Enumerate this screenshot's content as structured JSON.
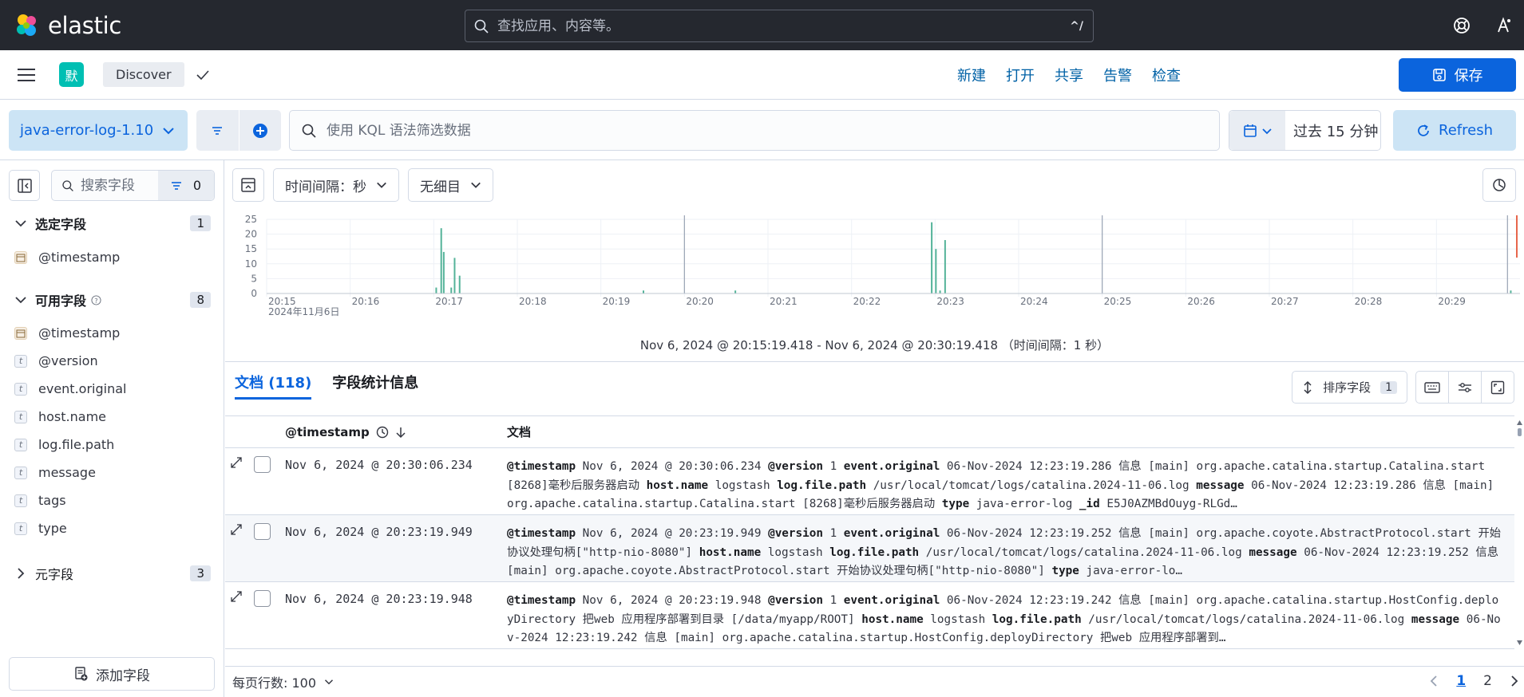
{
  "app": {
    "name": "elastic"
  },
  "global_search": {
    "placeholder": "查找应用、内容等。",
    "shortcut": "^/"
  },
  "header": {
    "space_initial": "默",
    "breadcrumb": "Discover",
    "links": [
      "新建",
      "打开",
      "共享",
      "告警",
      "检查"
    ],
    "save_label": "保存"
  },
  "querybar": {
    "dataview": "java-error-log-1.10",
    "kql_placeholder": "使用 KQL 语法筛选数据",
    "time_range": "过去 15 分钟",
    "refresh_label": "Refresh"
  },
  "sidebar": {
    "search_placeholder": "搜索字段",
    "filter_count": "0",
    "selected": {
      "label": "选定字段",
      "count": "1",
      "fields": [
        {
          "name": "@timestamp",
          "type": "date"
        }
      ]
    },
    "available": {
      "label": "可用字段",
      "count": "8",
      "fields": [
        {
          "name": "@timestamp",
          "type": "date"
        },
        {
          "name": "@version",
          "type": "t"
        },
        {
          "name": "event.original",
          "type": "t"
        },
        {
          "name": "host.name",
          "type": "t"
        },
        {
          "name": "log.file.path",
          "type": "t"
        },
        {
          "name": "message",
          "type": "t"
        },
        {
          "name": "tags",
          "type": "t"
        },
        {
          "name": "type",
          "type": "t"
        }
      ]
    },
    "meta": {
      "label": "元字段",
      "count": "3"
    },
    "add_field_label": "添加字段"
  },
  "chart_toolbar": {
    "interval": "时间间隔：秒",
    "breakdown": "无细目"
  },
  "chart_data": {
    "type": "bar",
    "y_ticks": [
      0,
      5,
      10,
      15,
      20,
      25
    ],
    "ylim": [
      0,
      25
    ],
    "x_tick_labels": [
      "20:15",
      "20:16",
      "20:17",
      "20:18",
      "20:19",
      "20:20",
      "20:21",
      "20:22",
      "20:23",
      "20:24",
      "20:25",
      "20:26",
      "20:27",
      "20:28",
      "20:29"
    ],
    "x_date_label": "2024年11月6日",
    "xlim_minutes": [
      0,
      15
    ],
    "points": [
      {
        "minute": 2.02,
        "count": 2
      },
      {
        "minute": 2.08,
        "count": 22
      },
      {
        "minute": 2.11,
        "count": 14
      },
      {
        "minute": 2.2,
        "count": 2
      },
      {
        "minute": 2.24,
        "count": 12
      },
      {
        "minute": 2.3,
        "count": 6
      },
      {
        "minute": 4.5,
        "count": 1
      },
      {
        "minute": 5.6,
        "count": 1
      },
      {
        "minute": 7.95,
        "count": 24
      },
      {
        "minute": 8.0,
        "count": 15
      },
      {
        "minute": 8.05,
        "count": 1
      },
      {
        "minute": 8.11,
        "count": 18
      },
      {
        "minute": 14.88,
        "count": 1
      }
    ],
    "color": "#54b399",
    "caption": "Nov 6, 2024 @ 20:15:19.418 - Nov 6, 2024 @ 20:30:19.418 （时间间隔：1 秒）"
  },
  "docs": {
    "tab_docs": "文档 (118)",
    "tab_stats": "字段统计信息",
    "sort_label": "排序字段",
    "sort_count": "1",
    "col_timestamp": "@timestamp",
    "col_document": "文档",
    "rows": [
      {
        "ts": "Nov 6, 2024 @ 20:30:06.234",
        "doc": [
          {
            "k": "@timestamp",
            "v": "Nov 6, 2024 @ 20:30:06.234"
          },
          {
            "k": "@version",
            "v": "1"
          },
          {
            "k": "event.original",
            "v": "06-Nov-2024 12:23:19.286 信息 [main] org.apache.catalina.startup.Catalina.start [8268]毫秒后服务器启动"
          },
          {
            "k": "host.name",
            "v": "logstash"
          },
          {
            "k": "log.file.path",
            "v": "/usr/local/tomcat/logs/catalina.2024-11-06.log"
          },
          {
            "k": "message",
            "v": "06-Nov-2024 12:23:19.286 信息 [main] org.apache.catalina.startup.Catalina.start [8268]毫秒后服务器启动"
          },
          {
            "k": "type",
            "v": "java-error-log"
          },
          {
            "k": "_id",
            "v": "E5J0AZMBdOuyg-RLGd…"
          }
        ]
      },
      {
        "ts": "Nov 6, 2024 @ 20:23:19.949",
        "doc": [
          {
            "k": "@timestamp",
            "v": "Nov 6, 2024 @ 20:23:19.949"
          },
          {
            "k": "@version",
            "v": "1"
          },
          {
            "k": "event.original",
            "v": "06-Nov-2024 12:23:19.252 信息 [main] org.apache.coyote.AbstractProtocol.start 开始协议处理句柄[\"http-nio-8080\"]"
          },
          {
            "k": "host.name",
            "v": "logstash"
          },
          {
            "k": "log.file.path",
            "v": "/usr/local/tomcat/logs/catalina.2024-11-06.log"
          },
          {
            "k": "message",
            "v": "06-Nov-2024 12:23:19.252 信息 [main] org.apache.coyote.AbstractProtocol.start 开始协议处理句柄[\"http-nio-8080\"]"
          },
          {
            "k": "type",
            "v": "java-error-lo…"
          }
        ]
      },
      {
        "ts": "Nov 6, 2024 @ 20:23:19.948",
        "doc": [
          {
            "k": "@timestamp",
            "v": "Nov 6, 2024 @ 20:23:19.948"
          },
          {
            "k": "@version",
            "v": "1"
          },
          {
            "k": "event.original",
            "v": "06-Nov-2024 12:23:19.242 信息 [main] org.apache.catalina.startup.HostConfig.deployDirectory 把web 应用程序部署到目录 [/data/myapp/ROOT]"
          },
          {
            "k": "host.name",
            "v": "logstash"
          },
          {
            "k": "log.file.path",
            "v": "/usr/local/tomcat/logs/catalina.2024-11-06.log"
          },
          {
            "k": "message",
            "v": "06-Nov-2024 12:23:19.242 信息 [main] org.apache.catalina.startup.HostConfig.deployDirectory 把web 应用程序部署到…"
          }
        ]
      }
    ],
    "rows_per_page": "每页行数: 100",
    "pages": [
      "1",
      "2"
    ]
  },
  "colors": {
    "accent": "#0b64dd",
    "topbar": "#25282f",
    "bar": "#54b399"
  }
}
